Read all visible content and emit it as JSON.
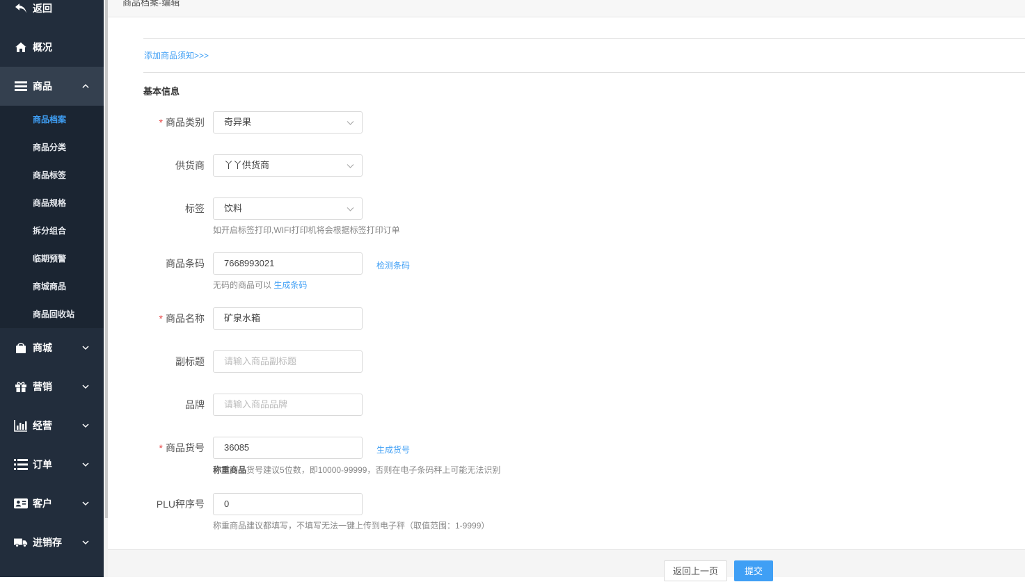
{
  "sidebar": {
    "back_label": "返回",
    "overview_label": "概况",
    "goods_label": "商品",
    "goods_sub": [
      "商品档案",
      "商品分类",
      "商品标签",
      "商品规格",
      "拆分组合",
      "临期预警",
      "商城商品",
      "商品回收站"
    ],
    "mall_label": "商城",
    "marketing_label": "营销",
    "business_label": "经营",
    "orders_label": "订单",
    "customers_label": "客户",
    "inventory_label": "进销存"
  },
  "header": {
    "breadcrumb": "商品档案-编辑"
  },
  "form": {
    "notice_link": "添加商品须知>>>",
    "section_title": "基本信息",
    "category": {
      "label": "商品类别",
      "value": "奇异果"
    },
    "supplier": {
      "label": "供货商",
      "value": "丫丫供货商"
    },
    "tag": {
      "label": "标签",
      "value": "饮料",
      "hint": "如开启标签打印,WIFI打印机将会根据标签打印订单"
    },
    "barcode": {
      "label": "商品条码",
      "value": "7668993021",
      "check_link": "检测条码",
      "hint_prefix": "无码的商品可以",
      "hint_link": "生成条码"
    },
    "name": {
      "label": "商品名称",
      "value": "矿泉水箱"
    },
    "subtitle": {
      "label": "副标题",
      "placeholder": "请输入商品副标题"
    },
    "brand": {
      "label": "品牌",
      "placeholder": "请输入商品品牌"
    },
    "item_no": {
      "label": "商品货号",
      "value": "36085",
      "gen_link": "生成货号",
      "hint_bold": "称重商品",
      "hint_rest": "货号建议5位数，即10000-99999，否则在电子条码秤上可能无法识别"
    },
    "plu": {
      "label": "PLU秤序号",
      "value": "0",
      "hint": "称重商品建议都填写，不填写无法一键上传到电子秤（取值范围：1-9999）"
    }
  },
  "footer": {
    "back_button": "返回上一页",
    "submit_button": "提交"
  }
}
